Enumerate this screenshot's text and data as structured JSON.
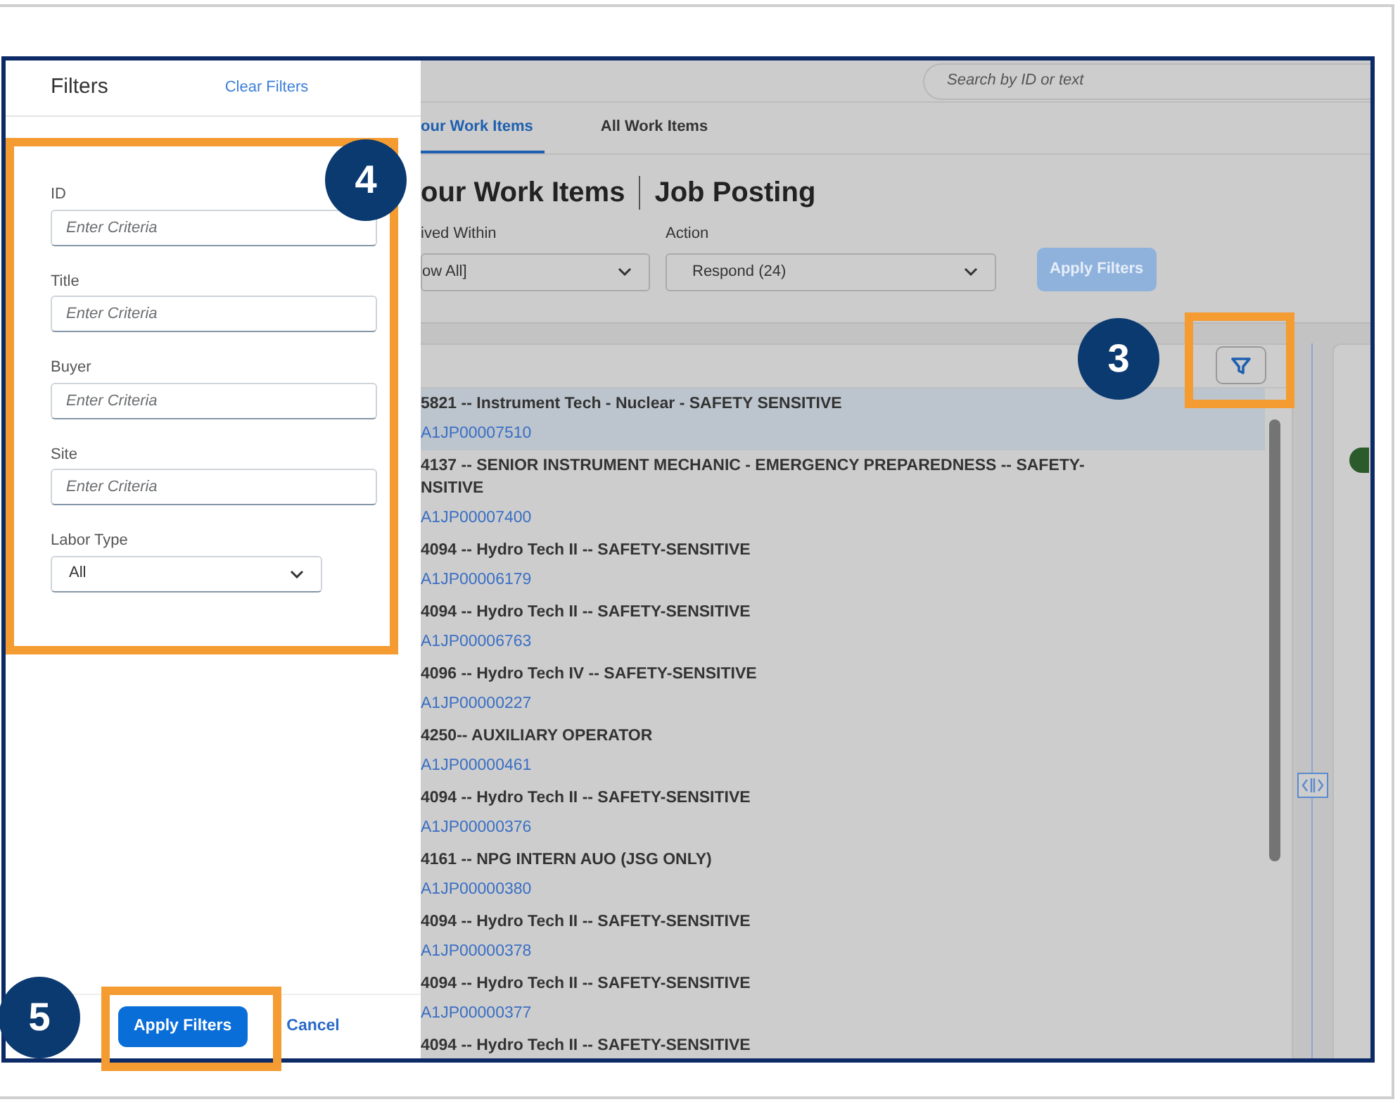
{
  "filters_panel": {
    "title": "Filters",
    "clear_link": "Clear Filters",
    "fields": [
      {
        "kind": "text",
        "label": "ID",
        "placeholder": "Enter Criteria"
      },
      {
        "kind": "text",
        "label": "Title",
        "placeholder": "Enter Criteria"
      },
      {
        "kind": "text",
        "label": "Buyer",
        "placeholder": "Enter Criteria"
      },
      {
        "kind": "text",
        "label": "Site",
        "placeholder": "Enter Criteria"
      },
      {
        "kind": "select",
        "label": "Labor Type",
        "value": "All"
      }
    ],
    "apply_button": "Apply Filters",
    "cancel_link": "Cancel"
  },
  "search": {
    "placeholder": "Search by ID or text"
  },
  "tabs": [
    {
      "label": "our Work Items",
      "selected": true
    },
    {
      "label": "All Work Items",
      "selected": false
    }
  ],
  "heading": {
    "title": "our Work Items",
    "subtitle": "Job Posting"
  },
  "filter_bar": {
    "fields": [
      {
        "label": "ived Within",
        "value": "ow All]"
      },
      {
        "label": "Action",
        "value": "Respond (24)"
      }
    ],
    "apply_button": {
      "label": "Apply Filters",
      "disabled": true
    }
  },
  "list": {
    "items": [
      {
        "title_lines": [
          "5821 -- Instrument Tech - Nuclear - SAFETY SENSITIVE"
        ],
        "id": "A1JP00007510",
        "selected": true
      },
      {
        "title_lines": [
          "4137 -- SENIOR INSTRUMENT MECHANIC - EMERGENCY PREPAREDNESS -- SAFETY-",
          "NSITIVE"
        ],
        "id": "A1JP00007400",
        "selected": false
      },
      {
        "title_lines": [
          "4094 -- Hydro Tech II -- SAFETY-SENSITIVE"
        ],
        "id": "A1JP00006179",
        "selected": false
      },
      {
        "title_lines": [
          "4094 -- Hydro Tech II -- SAFETY-SENSITIVE"
        ],
        "id": "A1JP00006763",
        "selected": false
      },
      {
        "title_lines": [
          "4096 -- Hydro Tech IV -- SAFETY-SENSITIVE"
        ],
        "id": "A1JP00000227",
        "selected": false
      },
      {
        "title_lines": [
          "4250-- AUXILIARY OPERATOR"
        ],
        "id": "A1JP00000461",
        "selected": false
      },
      {
        "title_lines": [
          "4094 -- Hydro Tech II -- SAFETY-SENSITIVE"
        ],
        "id": "A1JP00000376",
        "selected": false
      },
      {
        "title_lines": [
          "4161 -- NPG INTERN AUO (JSG ONLY)"
        ],
        "id": "A1JP00000380",
        "selected": false
      },
      {
        "title_lines": [
          "4094 -- Hydro Tech II -- SAFETY-SENSITIVE"
        ],
        "id": "A1JP00000378",
        "selected": false
      },
      {
        "title_lines": [
          "4094 -- Hydro Tech II -- SAFETY-SENSITIVE"
        ],
        "id": "A1JP00000377",
        "selected": false
      },
      {
        "title_lines": [
          "4094 -- Hydro Tech II -- SAFETY-SENSITIVE"
        ],
        "selected": false
      }
    ]
  },
  "callouts": [
    {
      "number": "4"
    },
    {
      "number": "3"
    },
    {
      "number": "5"
    }
  ]
}
